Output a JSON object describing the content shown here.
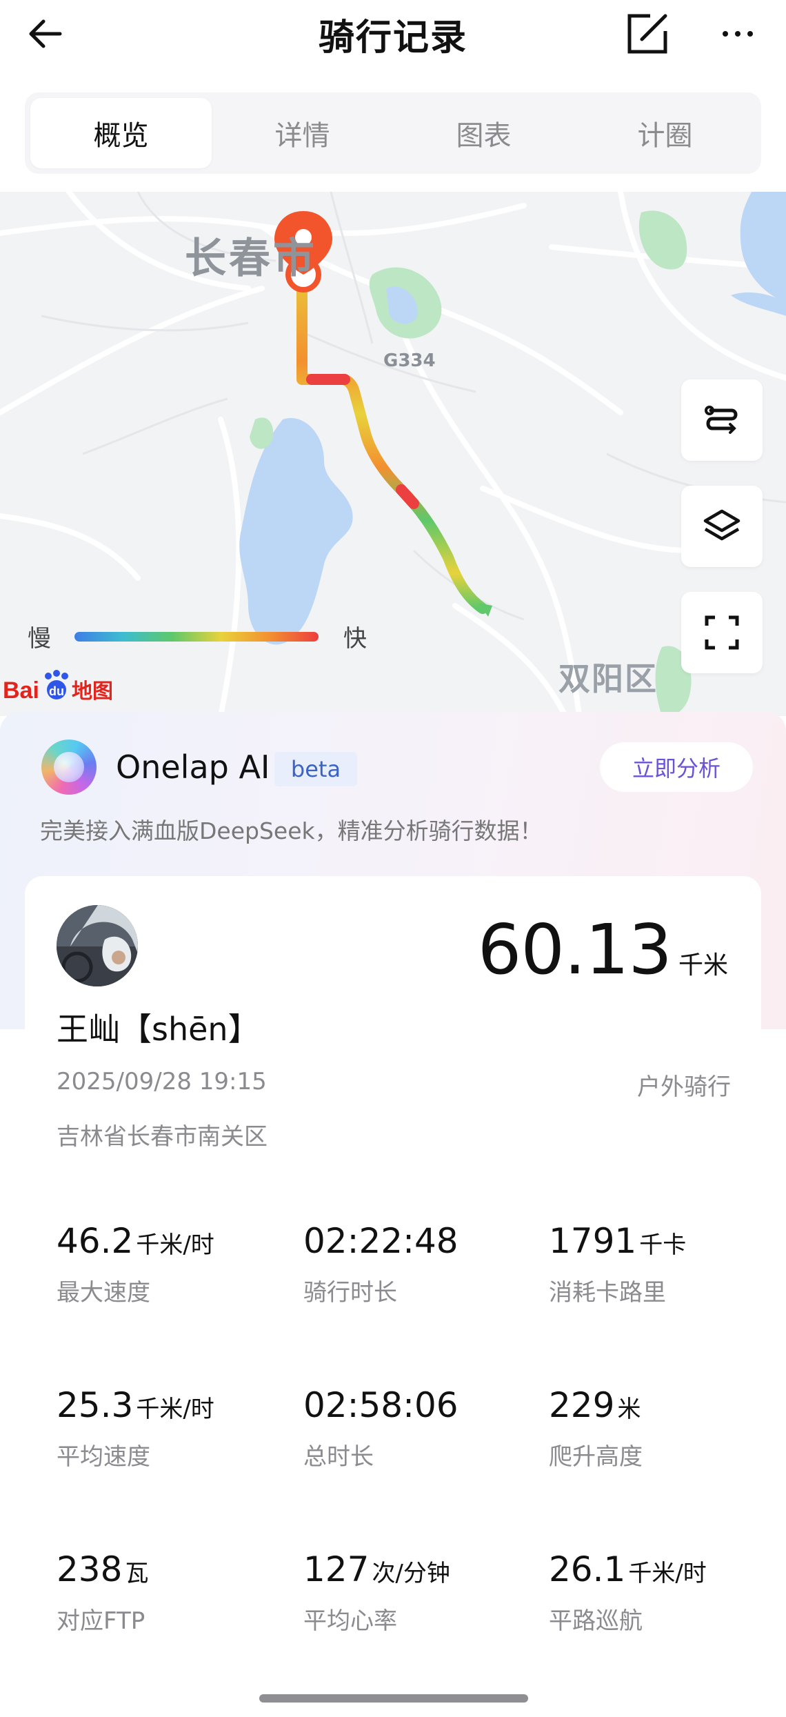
{
  "header": {
    "title": "骑行记录"
  },
  "tabs": [
    {
      "label": "概览",
      "active": true
    },
    {
      "label": "详情",
      "active": false
    },
    {
      "label": "图表",
      "active": false
    },
    {
      "label": "计圈",
      "active": false
    }
  ],
  "map": {
    "city_label": "长春市",
    "road_label": "G334",
    "district_label": "双阳区",
    "legend_slow": "慢",
    "legend_fast": "快",
    "provider": "Baidu 地图",
    "colors": {
      "slow": "#3f7fe6",
      "fast": "#ec3f3f",
      "pin": "#f2552c"
    }
  },
  "ai": {
    "name": "Onelap AI",
    "badge": "beta",
    "action_label": "立即分析",
    "description": "完美接入满血版DeepSeek，精准分析骑行数据！"
  },
  "ride": {
    "distance_value": "60.13",
    "distance_unit": "千米",
    "user_name": "王屾【shēn】",
    "datetime": "2025/09/28 19:15",
    "type": "户外骑行",
    "location": "吉林省长春市南关区"
  },
  "metrics": [
    {
      "value": "46.2",
      "unit": "千米/时",
      "label": "最大速度"
    },
    {
      "value": "02:22:48",
      "unit": "",
      "label": "骑行时长"
    },
    {
      "value": "1791",
      "unit": "千卡",
      "label": "消耗卡路里"
    },
    {
      "value": "25.3",
      "unit": "千米/时",
      "label": "平均速度"
    },
    {
      "value": "02:58:06",
      "unit": "",
      "label": "总时长"
    },
    {
      "value": "229",
      "unit": "米",
      "label": "爬升高度"
    },
    {
      "value": "238",
      "unit": "瓦",
      "label": "对应FTP"
    },
    {
      "value": "127",
      "unit": "次/分钟",
      "label": "平均心率"
    },
    {
      "value": "26.1",
      "unit": "千米/时",
      "label": "平路巡航"
    }
  ]
}
